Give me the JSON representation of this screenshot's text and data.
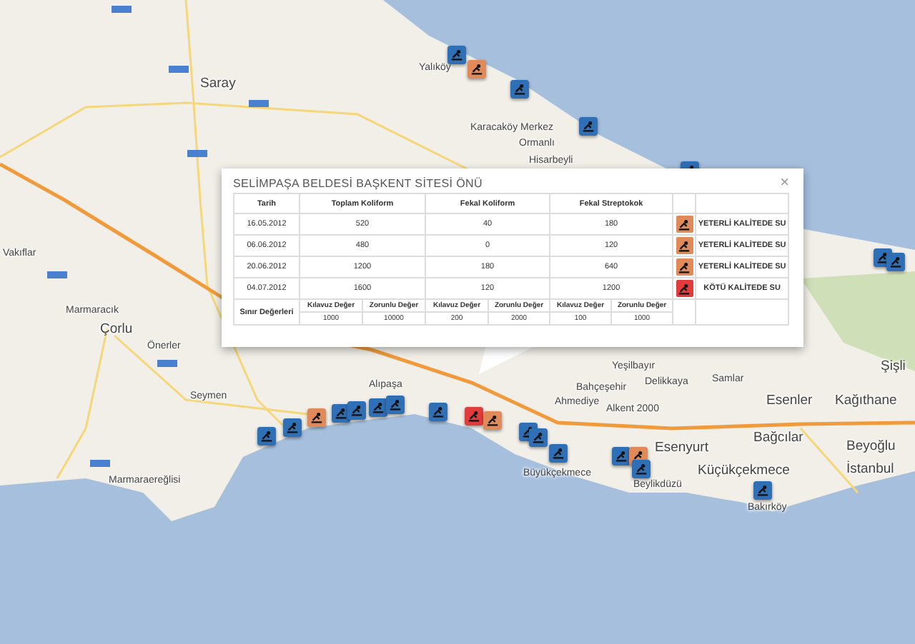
{
  "map": {
    "places": [
      {
        "name": "Saray"
      },
      {
        "name": "Yalıköy"
      },
      {
        "name": "Karacaköy Merkez"
      },
      {
        "name": "Ormanlı"
      },
      {
        "name": "Hisarbeyli"
      },
      {
        "name": "Vakıflar"
      },
      {
        "name": "Marmaracık"
      },
      {
        "name": "Çorlu"
      },
      {
        "name": "Önerler"
      },
      {
        "name": "Seymen"
      },
      {
        "name": "Marmaraereğlisi"
      },
      {
        "name": "Alıpaşa"
      },
      {
        "name": "Ahmediye"
      },
      {
        "name": "Yeşilbayır"
      },
      {
        "name": "Delikkaya"
      },
      {
        "name": "Samlar"
      },
      {
        "name": "Bahçeşehir"
      },
      {
        "name": "Alkent 2000"
      },
      {
        "name": "Esenler"
      },
      {
        "name": "Kağıthane"
      },
      {
        "name": "Bağcılar"
      },
      {
        "name": "Beyoğlu"
      },
      {
        "name": "İstanbul"
      },
      {
        "name": "Esenyurt"
      },
      {
        "name": "Küçükçekmece"
      },
      {
        "name": "Beylikdüzü"
      },
      {
        "name": "Bakırköy"
      },
      {
        "name": "Büyükçekmece"
      },
      {
        "name": "Şişli"
      }
    ],
    "markers": [
      {
        "color": "#2f6fb5"
      },
      {
        "color": "#e08a5a"
      },
      {
        "color": "#2f6fb5"
      },
      {
        "color": "#2f6fb5"
      },
      {
        "color": "#2f6fb5"
      },
      {
        "color": "#2f6fb5"
      },
      {
        "color": "#2f6fb5"
      },
      {
        "color": "#2f6fb5"
      },
      {
        "color": "#2f6fb5"
      },
      {
        "color": "#e08a5a"
      },
      {
        "color": "#2f6fb5"
      },
      {
        "color": "#2f6fb5"
      },
      {
        "color": "#2f6fb5"
      },
      {
        "color": "#2f6fb5"
      },
      {
        "color": "#2f6fb5"
      },
      {
        "color": "#e23b3b"
      },
      {
        "color": "#e08a5a"
      },
      {
        "color": "#2f6fb5"
      },
      {
        "color": "#2f6fb5"
      },
      {
        "color": "#2f6fb5"
      },
      {
        "color": "#2f6fb5"
      },
      {
        "color": "#e08a5a"
      },
      {
        "color": "#2f6fb5"
      },
      {
        "color": "#2f6fb5"
      }
    ]
  },
  "popup": {
    "title": "SELİMPAŞA BELDESİ BAŞKENT SİTESİ ÖNÜ",
    "close": "×",
    "columns": [
      "Tarih",
      "Toplam Koliform",
      "Fekal Koliform",
      "Fekal Streptokok"
    ],
    "rows": [
      {
        "date": "16.05.2012",
        "values": [
          "520",
          "40",
          "180"
        ],
        "color": "#e08a5a",
        "status": "YETERLİ KALİTEDE SU"
      },
      {
        "date": "06.06.2012",
        "values": [
          "480",
          "0",
          "120"
        ],
        "color": "#e08a5a",
        "status": "YETERLİ KALİTEDE SU"
      },
      {
        "date": "20.06.2012",
        "values": [
          "1200",
          "180",
          "640"
        ],
        "color": "#e08a5a",
        "status": "YETERLİ KALİTEDE SU"
      },
      {
        "date": "04.07.2012",
        "values": [
          "1600",
          "120",
          "1200"
        ],
        "color": "#e23b3b",
        "status": "KÖTÜ KALİTEDE SU"
      }
    ],
    "limits": {
      "label": "Sınır Değerleri",
      "groups": [
        {
          "headers": [
            "Kılavuz Değer",
            "Zorunlu Değer"
          ],
          "values": [
            "1000",
            "10000"
          ]
        },
        {
          "headers": [
            "Kılavuz Değer",
            "Zorunlu Değer"
          ],
          "values": [
            "200",
            "2000"
          ]
        },
        {
          "headers": [
            "Kılavuz Değer",
            "Zorunlu Değer"
          ],
          "values": [
            "100",
            "1000"
          ]
        }
      ]
    }
  }
}
